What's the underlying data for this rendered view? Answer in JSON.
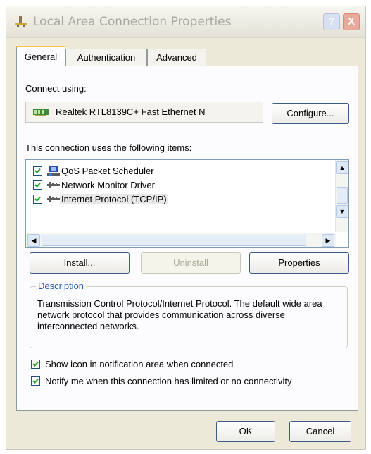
{
  "window": {
    "title": "Local Area Connection Properties"
  },
  "titlebar": {
    "help_glyph": "?",
    "close_glyph": "X"
  },
  "tabs": [
    {
      "label": "General",
      "active": true
    },
    {
      "label": "Authentication",
      "active": false
    },
    {
      "label": "Advanced",
      "active": false
    }
  ],
  "general": {
    "connect_using_label": "Connect using:",
    "adapter_name": "Realtek RTL8139C+ Fast Ethernet N",
    "configure_button": "Configure...",
    "items_label": "This connection uses the following items:",
    "items": [
      {
        "label": "QoS Packet Scheduler",
        "checked": true,
        "icon": "scheduler-icon"
      },
      {
        "label": "Network Monitor Driver",
        "checked": true,
        "icon": "protocol-icon"
      },
      {
        "label": "Internet Protocol (TCP/IP)",
        "checked": true,
        "icon": "protocol-icon",
        "selected": true
      }
    ],
    "install_button": "Install...",
    "uninstall_button": "Uninstall",
    "properties_button": "Properties",
    "description_title": "Description",
    "description_text": "Transmission Control Protocol/Internet Protocol. The default wide area network protocol that provides communication across diverse interconnected networks.",
    "show_icon_label": "Show icon in notification area when connected",
    "notify_label": "Notify me when this connection has limited or no connectivity"
  },
  "footer": {
    "ok_button": "OK",
    "cancel_button": "Cancel"
  },
  "colors": {
    "window_bg": "#ece9d8",
    "panel_bg": "#fcfcfe",
    "group_title": "#1f5fb6",
    "button_border": "#3e5b88"
  }
}
